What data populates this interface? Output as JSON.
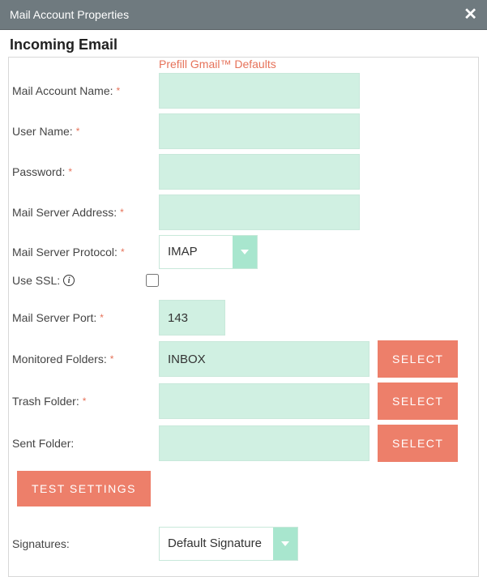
{
  "header": {
    "title": "Mail Account Properties"
  },
  "section": {
    "title": "Incoming Email"
  },
  "prefill": {
    "label": "Prefill Gmail™ Defaults"
  },
  "labels": {
    "account_name": "Mail Account Name:",
    "user_name": "User Name:",
    "password": "Password:",
    "server_address": "Mail Server Address:",
    "server_protocol": "Mail Server Protocol:",
    "use_ssl": "Use SSL:",
    "server_port": "Mail Server Port:",
    "monitored_folders": "Monitored Folders:",
    "trash_folder": "Trash Folder:",
    "sent_folder": "Sent Folder:",
    "signatures": "Signatures:"
  },
  "values": {
    "account_name": "",
    "user_name": "",
    "password": "",
    "server_address": "",
    "server_protocol": "IMAP",
    "use_ssl": false,
    "server_port": "143",
    "monitored_folders": "INBOX",
    "trash_folder": "",
    "sent_folder": "",
    "signature": "Default Signature"
  },
  "buttons": {
    "select": "SELECT",
    "test_settings": "TEST SETTINGS"
  }
}
